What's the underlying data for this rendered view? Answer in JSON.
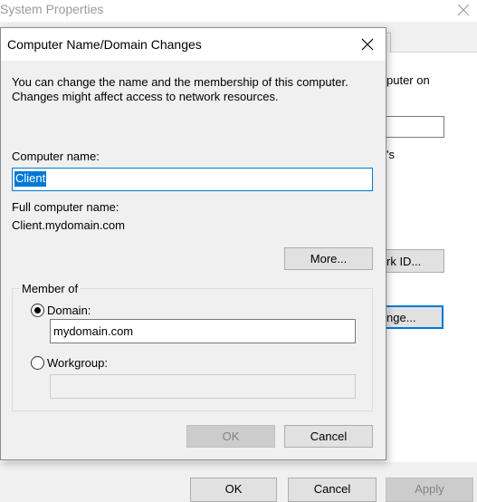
{
  "system_properties": {
    "title": "System Properties",
    "desc_fragment": "puter on",
    "desc_fragment2": "'s",
    "network_id_button": "rk ID...",
    "change_button": "nge...",
    "ok_button": "OK",
    "cancel_button": "Cancel",
    "apply_button": "Apply"
  },
  "dialog": {
    "title": "Computer Name/Domain Changes",
    "description_line1": "You can change the name and the membership of this computer.",
    "description_line2": "Changes might affect access to network resources.",
    "computer_name_label": "Computer name:",
    "computer_name_value": "Client",
    "full_name_label": "Full computer name:",
    "full_name_value": "Client.mydomain.com",
    "more_button": "More...",
    "member_of": {
      "legend": "Member of",
      "domain_label": "Domain:",
      "domain_value": "mydomain.com",
      "workgroup_label": "Workgroup:",
      "workgroup_value": "",
      "selected": "domain"
    },
    "ok_button": "OK",
    "cancel_button": "Cancel"
  },
  "colors": {
    "accent": "#0078d7",
    "window_bg": "#f0f0f0",
    "disabled_text": "#838383"
  }
}
